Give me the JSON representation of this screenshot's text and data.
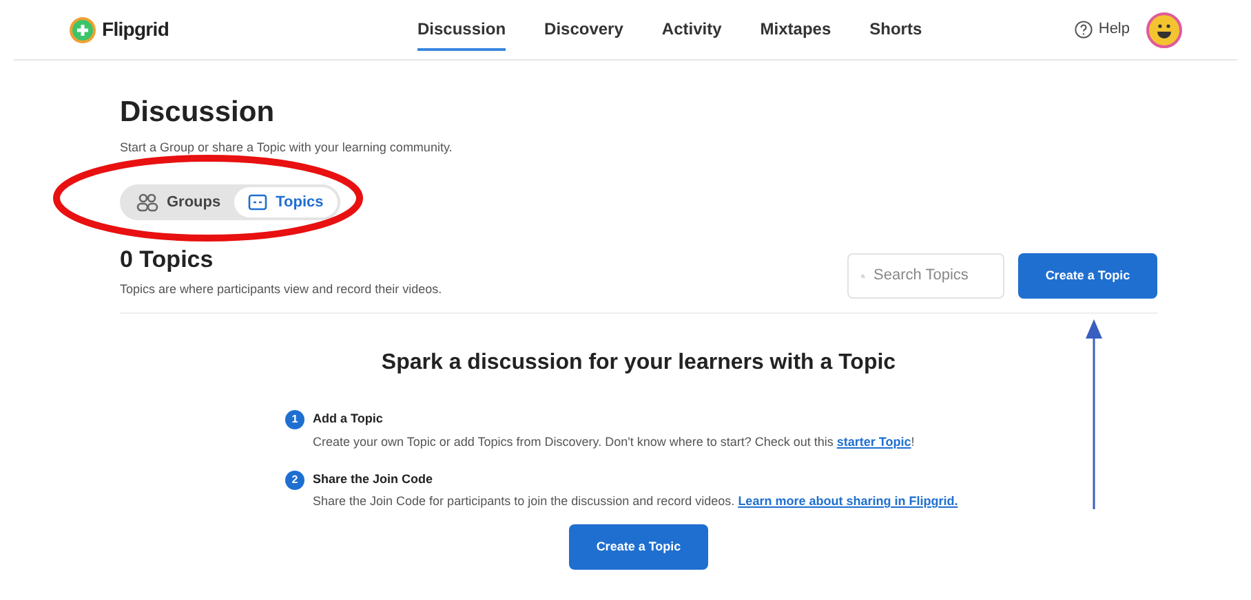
{
  "header": {
    "brand": "Flipgrid",
    "nav": [
      {
        "label": "Discussion",
        "selected": true
      },
      {
        "label": "Discovery",
        "selected": false
      },
      {
        "label": "Activity",
        "selected": false
      },
      {
        "label": "Mixtapes",
        "selected": false
      },
      {
        "label": "Shorts",
        "selected": false
      }
    ],
    "help": "Help"
  },
  "page": {
    "title": "Discussion",
    "subtitle": "Start a Group or share a Topic with your learning community.",
    "toggle": [
      {
        "label": "Groups",
        "kind": "groups",
        "selected": false
      },
      {
        "label": "Topics",
        "kind": "topics",
        "selected": true
      }
    ],
    "count_title": "0 Topics",
    "count_subtitle": "Topics are where participants view and record their videos.",
    "search": {
      "placeholder": "Search Topics"
    },
    "create_button": "Create a Topic"
  },
  "empty_state": {
    "heading": "Spark a discussion for your learners with a Topic",
    "steps": [
      {
        "number": "1",
        "title": "Add a Topic",
        "text": "Create your own Topic or add Topics from Discovery. Don't know where to start? Check out this ",
        "link": "starter Topic",
        "after": "!"
      },
      {
        "number": "2",
        "title": "Share the Join Code",
        "text": "Share the Join Code for participants to join the discussion and record videos. ",
        "link": "Learn more about sharing in Flipgrid."
      }
    ],
    "button": "Create a Topic"
  }
}
